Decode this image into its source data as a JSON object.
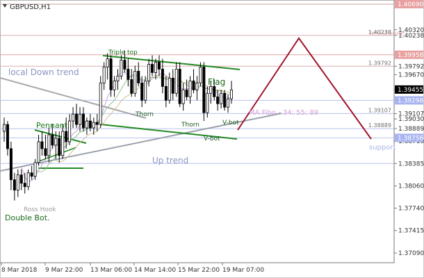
{
  "header": {
    "dropdown_icon": "triangle-down-icon",
    "symbol": "GBPUSD,H1"
  },
  "chart_data": {
    "type": "candlestick",
    "symbol": "GBPUSD",
    "timeframe": "H1",
    "ylim": [
      1.3695,
      1.4075
    ],
    "y_ticks": [
      "1.40238",
      "1.39792",
      "1.39455",
      "1.39107",
      "1.38889",
      "1.38385",
      "1.38060",
      "1.37740",
      "1.37415",
      "1.37090",
      "1.40320",
      "1.39670",
      "1.39030",
      "1.38710"
    ],
    "x_ticks": [
      "8 Mar 2018",
      "9 Mar 22:00",
      "13 Mar 06:00",
      "14 Mar 14:00",
      "15 Mar 22:00",
      "19 Mar 07:00"
    ],
    "current_price": "1.39455",
    "price_tags": [
      {
        "label": "1.40690",
        "value": 1.4069,
        "color": "#e8a0a0"
      },
      {
        "label": "1.39958",
        "value": 1.39958,
        "color": "#e8a0a0"
      },
      {
        "label": "1.39298",
        "value": 1.39298,
        "color": "#a8b4f0"
      },
      {
        "label": "1.38756",
        "value": 1.38756,
        "color": "#a8b4f0"
      }
    ],
    "level_labels": [
      {
        "label": "1.40238",
        "value": 1.40238
      },
      {
        "label": "1.39792",
        "value": 1.39792
      },
      {
        "label": "1.39107",
        "value": 1.39107
      },
      {
        "label": "1.38889",
        "value": 1.38889
      }
    ],
    "horizontal_levels": [
      {
        "value": 1.4069,
        "color": "#c8a0a0"
      },
      {
        "value": 1.40238,
        "color": "#d8b0b0"
      },
      {
        "value": 1.39958,
        "color": "#e0a0a0"
      },
      {
        "value": 1.39792,
        "color": "#d8b0b0"
      },
      {
        "value": 1.39298,
        "color": "#b8c0f0"
      },
      {
        "value": 1.39107,
        "color": "#b8c0f0"
      },
      {
        "value": 1.38889,
        "color": "#b8c0f0"
      },
      {
        "value": 1.38756,
        "color": "#b8c0f0"
      },
      {
        "value": 1.38385,
        "color": "#b8c0f0"
      }
    ],
    "annotations": {
      "resistance": "resistance",
      "support": "support",
      "local_down_trend": "local Down trend",
      "up_trend": "Up trend",
      "pennant": "Pennant",
      "triple_top": "Triple top",
      "flag": "Flag",
      "thorn_1": "Thorn",
      "thorn_2": "Thorn",
      "v_bot_1": "V-bot",
      "v_bot_2": "V-bot",
      "ma_fibo": "MA Fibo - 34; 55; 89",
      "ross_hook": "Ross Hook",
      "double_bot": "Double Bot."
    },
    "candles": [
      {
        "o": 1.3885,
        "h": 1.3905,
        "l": 1.387,
        "c": 1.3895
      },
      {
        "o": 1.3895,
        "h": 1.39,
        "l": 1.385,
        "c": 1.386
      },
      {
        "o": 1.386,
        "h": 1.387,
        "l": 1.38,
        "c": 1.3815
      },
      {
        "o": 1.3815,
        "h": 1.3825,
        "l": 1.3785,
        "c": 1.38
      },
      {
        "o": 1.38,
        "h": 1.383,
        "l": 1.379,
        "c": 1.3822
      },
      {
        "o": 1.3822,
        "h": 1.383,
        "l": 1.38,
        "c": 1.381
      },
      {
        "o": 1.381,
        "h": 1.3825,
        "l": 1.3795,
        "c": 1.3805
      },
      {
        "o": 1.3805,
        "h": 1.383,
        "l": 1.38,
        "c": 1.3825
      },
      {
        "o": 1.3825,
        "h": 1.3835,
        "l": 1.3815,
        "c": 1.382
      },
      {
        "o": 1.382,
        "h": 1.3845,
        "l": 1.3815,
        "c": 1.384
      },
      {
        "o": 1.384,
        "h": 1.388,
        "l": 1.3835,
        "c": 1.387
      },
      {
        "o": 1.387,
        "h": 1.3885,
        "l": 1.385,
        "c": 1.386
      },
      {
        "o": 1.386,
        "h": 1.388,
        "l": 1.3845,
        "c": 1.385
      },
      {
        "o": 1.385,
        "h": 1.389,
        "l": 1.384,
        "c": 1.388
      },
      {
        "o": 1.388,
        "h": 1.3895,
        "l": 1.386,
        "c": 1.3865
      },
      {
        "o": 1.3865,
        "h": 1.3885,
        "l": 1.3845,
        "c": 1.3875
      },
      {
        "o": 1.3875,
        "h": 1.3885,
        "l": 1.384,
        "c": 1.385
      },
      {
        "o": 1.385,
        "h": 1.3895,
        "l": 1.3845,
        "c": 1.3885
      },
      {
        "o": 1.3885,
        "h": 1.3905,
        "l": 1.386,
        "c": 1.387
      },
      {
        "o": 1.387,
        "h": 1.391,
        "l": 1.3865,
        "c": 1.39
      },
      {
        "o": 1.39,
        "h": 1.392,
        "l": 1.389,
        "c": 1.391
      },
      {
        "o": 1.391,
        "h": 1.3925,
        "l": 1.389,
        "c": 1.3895
      },
      {
        "o": 1.3895,
        "h": 1.392,
        "l": 1.3885,
        "c": 1.391
      },
      {
        "o": 1.391,
        "h": 1.392,
        "l": 1.3885,
        "c": 1.389
      },
      {
        "o": 1.389,
        "h": 1.3905,
        "l": 1.388,
        "c": 1.39
      },
      {
        "o": 1.39,
        "h": 1.391,
        "l": 1.3885,
        "c": 1.389
      },
      {
        "o": 1.389,
        "h": 1.3905,
        "l": 1.388,
        "c": 1.3898
      },
      {
        "o": 1.3898,
        "h": 1.391,
        "l": 1.3885,
        "c": 1.3895
      },
      {
        "o": 1.3895,
        "h": 1.3965,
        "l": 1.389,
        "c": 1.3955
      },
      {
        "o": 1.3955,
        "h": 1.3985,
        "l": 1.3945,
        "c": 1.3978
      },
      {
        "o": 1.3978,
        "h": 1.3998,
        "l": 1.396,
        "c": 1.399
      },
      {
        "o": 1.399,
        "h": 1.3995,
        "l": 1.3935,
        "c": 1.3945
      },
      {
        "o": 1.3945,
        "h": 1.3965,
        "l": 1.3935,
        "c": 1.3958
      },
      {
        "o": 1.3958,
        "h": 1.3975,
        "l": 1.3945,
        "c": 1.3965
      },
      {
        "o": 1.3965,
        "h": 1.3995,
        "l": 1.396,
        "c": 1.3988
      },
      {
        "o": 1.3988,
        "h": 1.4002,
        "l": 1.397,
        "c": 1.3975
      },
      {
        "o": 1.3975,
        "h": 1.399,
        "l": 1.395,
        "c": 1.396
      },
      {
        "o": 1.396,
        "h": 1.3975,
        "l": 1.3935,
        "c": 1.394
      },
      {
        "o": 1.394,
        "h": 1.398,
        "l": 1.3935,
        "c": 1.3972
      },
      {
        "o": 1.3972,
        "h": 1.3985,
        "l": 1.395,
        "c": 1.3955
      },
      {
        "o": 1.3955,
        "h": 1.3965,
        "l": 1.392,
        "c": 1.393
      },
      {
        "o": 1.393,
        "h": 1.3965,
        "l": 1.3925,
        "c": 1.3958
      },
      {
        "o": 1.3958,
        "h": 1.399,
        "l": 1.395,
        "c": 1.3982
      },
      {
        "o": 1.3982,
        "h": 1.3995,
        "l": 1.3965,
        "c": 1.397
      },
      {
        "o": 1.397,
        "h": 1.399,
        "l": 1.396,
        "c": 1.3985
      },
      {
        "o": 1.3985,
        "h": 1.3995,
        "l": 1.3965,
        "c": 1.3975
      },
      {
        "o": 1.3975,
        "h": 1.399,
        "l": 1.394,
        "c": 1.395
      },
      {
        "o": 1.395,
        "h": 1.3965,
        "l": 1.392,
        "c": 1.393
      },
      {
        "o": 1.393,
        "h": 1.397,
        "l": 1.3925,
        "c": 1.3962
      },
      {
        "o": 1.3962,
        "h": 1.3975,
        "l": 1.393,
        "c": 1.394
      },
      {
        "o": 1.394,
        "h": 1.3985,
        "l": 1.3935,
        "c": 1.3975
      },
      {
        "o": 1.3975,
        "h": 1.3985,
        "l": 1.392,
        "c": 1.3925
      },
      {
        "o": 1.3925,
        "h": 1.3955,
        "l": 1.3915,
        "c": 1.3945
      },
      {
        "o": 1.3945,
        "h": 1.396,
        "l": 1.393,
        "c": 1.3935
      },
      {
        "o": 1.3935,
        "h": 1.3965,
        "l": 1.3925,
        "c": 1.3958
      },
      {
        "o": 1.3958,
        "h": 1.3975,
        "l": 1.394,
        "c": 1.3945
      },
      {
        "o": 1.3945,
        "h": 1.3965,
        "l": 1.393,
        "c": 1.3955
      },
      {
        "o": 1.3955,
        "h": 1.3985,
        "l": 1.395,
        "c": 1.3978
      },
      {
        "o": 1.3978,
        "h": 1.3985,
        "l": 1.39,
        "c": 1.3912
      },
      {
        "o": 1.3912,
        "h": 1.395,
        "l": 1.3905,
        "c": 1.394
      },
      {
        "o": 1.394,
        "h": 1.3958,
        "l": 1.3925,
        "c": 1.395
      },
      {
        "o": 1.395,
        "h": 1.396,
        "l": 1.393,
        "c": 1.3935
      },
      {
        "o": 1.3935,
        "h": 1.3945,
        "l": 1.3915,
        "c": 1.3925
      },
      {
        "o": 1.3925,
        "h": 1.3945,
        "l": 1.3918,
        "c": 1.394
      },
      {
        "o": 1.394,
        "h": 1.3945,
        "l": 1.3915,
        "c": 1.392
      },
      {
        "o": 1.392,
        "h": 1.3938,
        "l": 1.3912,
        "c": 1.3932
      },
      {
        "o": 1.3932,
        "h": 1.3958,
        "l": 1.3925,
        "c": 1.3945
      }
    ]
  }
}
